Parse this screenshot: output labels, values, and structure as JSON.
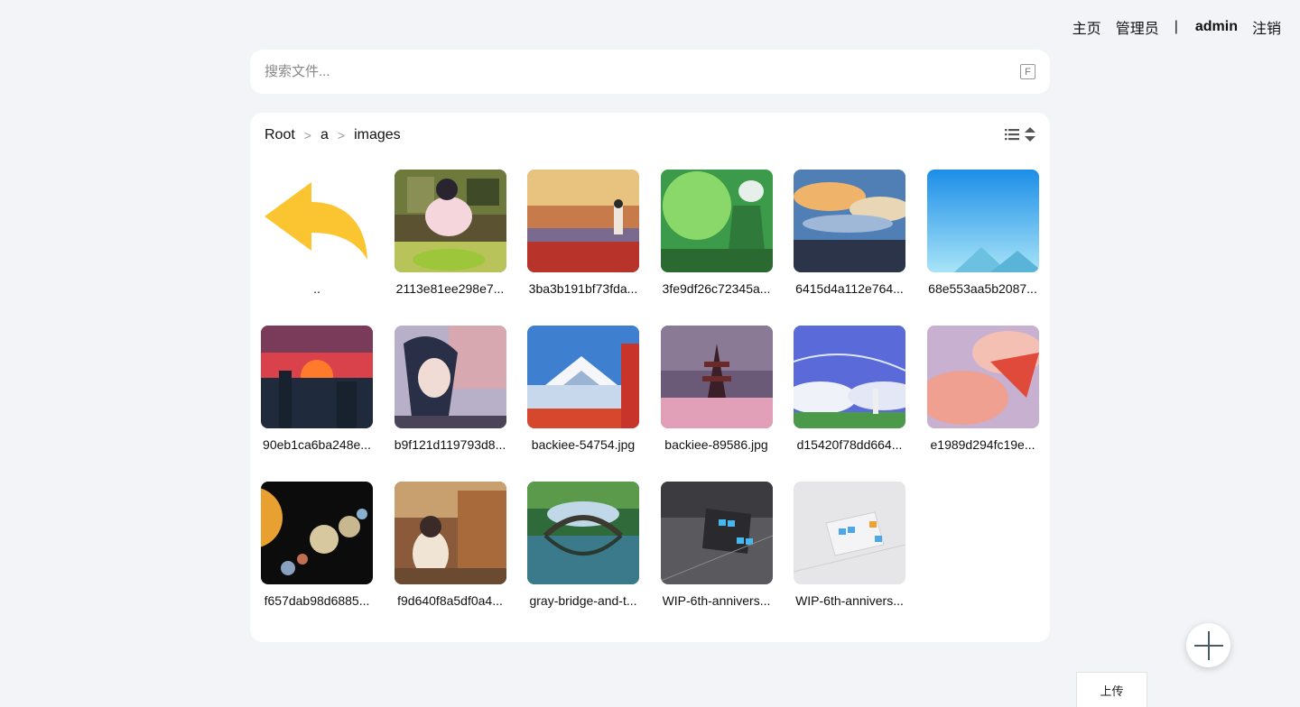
{
  "nav": {
    "home": "主页",
    "admin_panel": "管理员",
    "separator": "|",
    "user": "admin",
    "logout": "注销"
  },
  "search": {
    "placeholder": "搜索文件...",
    "shortcut_key": "F"
  },
  "breadcrumb": [
    "Root",
    "a",
    "images"
  ],
  "breadcrumb_separator": ">",
  "files": [
    {
      "label": "..",
      "kind": "parent"
    },
    {
      "label": "2113e81ee298e7..."
    },
    {
      "label": "3ba3b191bf73fda..."
    },
    {
      "label": "3fe9df26c72345a..."
    },
    {
      "label": "6415d4a112e764..."
    },
    {
      "label": "68e553aa5b2087..."
    },
    {
      "label": "90eb1ca6ba248e..."
    },
    {
      "label": "b9f121d119793d8..."
    },
    {
      "label": "backiee-54754.jpg"
    },
    {
      "label": "backiee-89586.jpg"
    },
    {
      "label": "d15420f78dd664..."
    },
    {
      "label": "e1989d294fc19e..."
    },
    {
      "label": "f657dab98d6885..."
    },
    {
      "label": "f9d640f8a5df0a4..."
    },
    {
      "label": "gray-bridge-and-t..."
    },
    {
      "label": "WIP-6th-annivers..."
    },
    {
      "label": "WIP-6th-annivers..."
    }
  ],
  "upload_label": "上传",
  "colors": {
    "page_bg": "#f2f4f8",
    "panel_bg": "#ffffff",
    "back_arrow": "#fbc531",
    "fab_icon": "#4a5a63"
  },
  "icons": {
    "shortcut": "keyboard-key-icon",
    "list_view": "list-view-icon",
    "sort": "sort-icon",
    "back": "back-arrow-icon",
    "fab": "plus-icon"
  }
}
